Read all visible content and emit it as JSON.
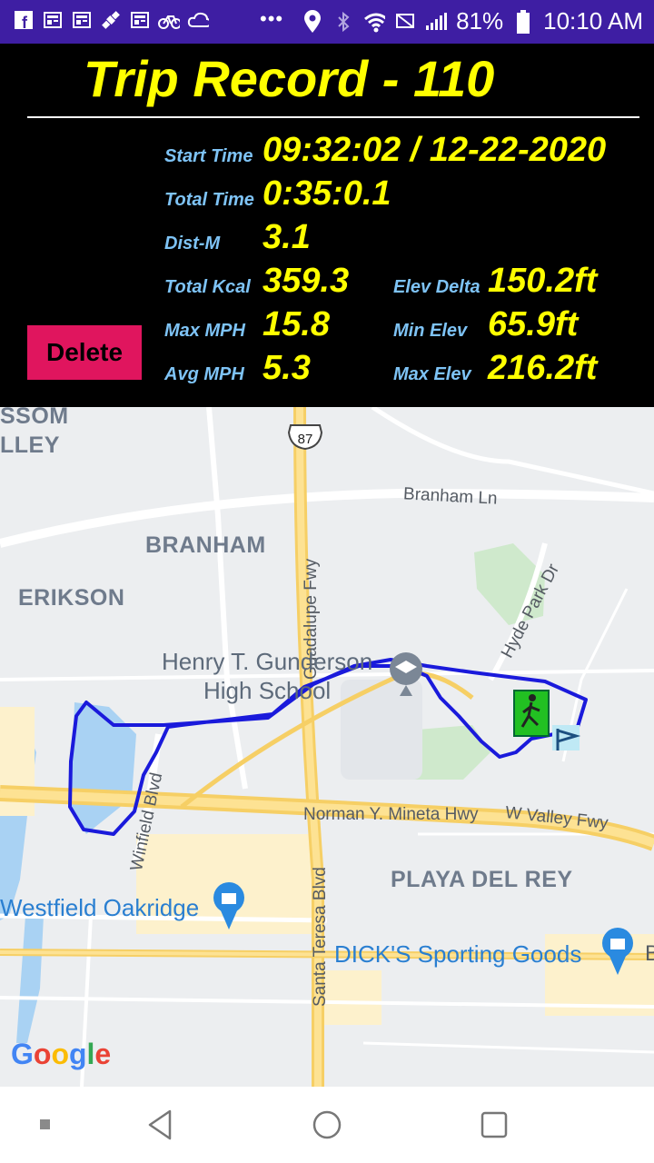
{
  "status_bar": {
    "icons": [
      "facebook-icon",
      "news-icon",
      "news-icon",
      "satellite-icon",
      "news-icon",
      "bike-icon",
      "cloud-icon"
    ],
    "more": "•••",
    "battery_text": "81%",
    "time": "10:10 AM"
  },
  "header": {
    "title": "Trip Record - 110",
    "start_time_label": "Start Time",
    "start_time_value": "09:32:02 / 12-22-2020",
    "total_time_label": "Total Time",
    "total_time_value": "0:35:0.1",
    "dist_label": "Dist-M",
    "dist_value": "3.1",
    "kcal_label": "Total Kcal",
    "kcal_value": "359.3",
    "max_mph_label": "Max MPH",
    "max_mph_value": "15.8",
    "avg_mph_label": "Avg MPH",
    "avg_mph_value": "5.3",
    "elev_delta_label": "Elev Delta",
    "elev_delta_value": "150.2ft",
    "min_elev_label": "Min Elev",
    "min_elev_value": "65.9ft",
    "max_elev_label": "Max Elev",
    "max_elev_value": "216.2ft",
    "delete_label": "Delete"
  },
  "map": {
    "areas": [
      "SSOM",
      "LLEY",
      "BRANHAM",
      "ERIKSON",
      "PLAYA DEL REY"
    ],
    "roads": [
      "Branham Ln",
      "Guadalupe Fwy",
      "Hyde Park Dr",
      "Winfield Blvd",
      "Norman Y. Mineta Hwy",
      "W Valley Fwy",
      "Santa Teresa Blvd"
    ],
    "highway_shield": "87",
    "school_line1": "Henry T. Gunderson",
    "school_line2": "High School",
    "mall": "Westfield Oakridge",
    "store": "DICK'S Sporting Goods",
    "partial_right": "B",
    "route_color": "#1a1adb",
    "attribution": "Google"
  },
  "nav_bar": {
    "buttons": [
      "square-small-icon",
      "back-icon",
      "home-icon",
      "recents-icon"
    ]
  }
}
